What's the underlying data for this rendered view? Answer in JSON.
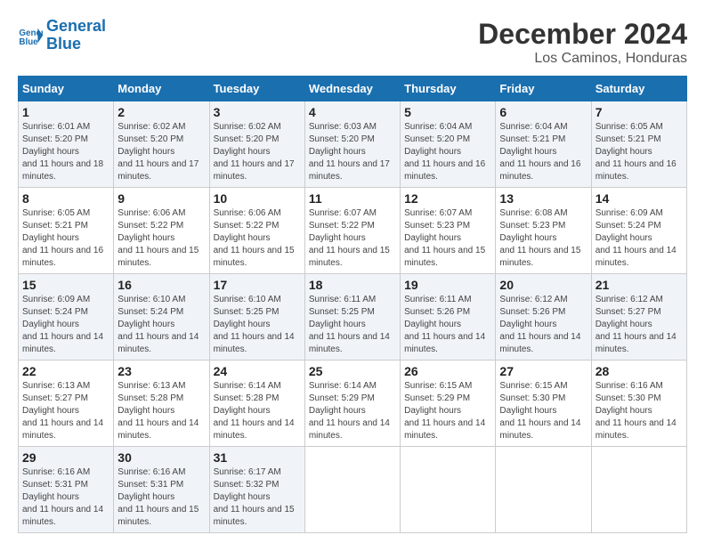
{
  "header": {
    "logo_line1": "General",
    "logo_line2": "Blue",
    "title": "December 2024",
    "subtitle": "Los Caminos, Honduras"
  },
  "calendar": {
    "days_of_week": [
      "Sunday",
      "Monday",
      "Tuesday",
      "Wednesday",
      "Thursday",
      "Friday",
      "Saturday"
    ],
    "weeks": [
      [
        {
          "day": "1",
          "sunrise": "6:01 AM",
          "sunset": "5:20 PM",
          "daylight": "11 hours and 18 minutes."
        },
        {
          "day": "2",
          "sunrise": "6:02 AM",
          "sunset": "5:20 PM",
          "daylight": "11 hours and 17 minutes."
        },
        {
          "day": "3",
          "sunrise": "6:02 AM",
          "sunset": "5:20 PM",
          "daylight": "11 hours and 17 minutes."
        },
        {
          "day": "4",
          "sunrise": "6:03 AM",
          "sunset": "5:20 PM",
          "daylight": "11 hours and 17 minutes."
        },
        {
          "day": "5",
          "sunrise": "6:04 AM",
          "sunset": "5:20 PM",
          "daylight": "11 hours and 16 minutes."
        },
        {
          "day": "6",
          "sunrise": "6:04 AM",
          "sunset": "5:21 PM",
          "daylight": "11 hours and 16 minutes."
        },
        {
          "day": "7",
          "sunrise": "6:05 AM",
          "sunset": "5:21 PM",
          "daylight": "11 hours and 16 minutes."
        }
      ],
      [
        {
          "day": "8",
          "sunrise": "6:05 AM",
          "sunset": "5:21 PM",
          "daylight": "11 hours and 16 minutes."
        },
        {
          "day": "9",
          "sunrise": "6:06 AM",
          "sunset": "5:22 PM",
          "daylight": "11 hours and 15 minutes."
        },
        {
          "day": "10",
          "sunrise": "6:06 AM",
          "sunset": "5:22 PM",
          "daylight": "11 hours and 15 minutes."
        },
        {
          "day": "11",
          "sunrise": "6:07 AM",
          "sunset": "5:22 PM",
          "daylight": "11 hours and 15 minutes."
        },
        {
          "day": "12",
          "sunrise": "6:07 AM",
          "sunset": "5:23 PM",
          "daylight": "11 hours and 15 minutes."
        },
        {
          "day": "13",
          "sunrise": "6:08 AM",
          "sunset": "5:23 PM",
          "daylight": "11 hours and 15 minutes."
        },
        {
          "day": "14",
          "sunrise": "6:09 AM",
          "sunset": "5:24 PM",
          "daylight": "11 hours and 14 minutes."
        }
      ],
      [
        {
          "day": "15",
          "sunrise": "6:09 AM",
          "sunset": "5:24 PM",
          "daylight": "11 hours and 14 minutes."
        },
        {
          "day": "16",
          "sunrise": "6:10 AM",
          "sunset": "5:24 PM",
          "daylight": "11 hours and 14 minutes."
        },
        {
          "day": "17",
          "sunrise": "6:10 AM",
          "sunset": "5:25 PM",
          "daylight": "11 hours and 14 minutes."
        },
        {
          "day": "18",
          "sunrise": "6:11 AM",
          "sunset": "5:25 PM",
          "daylight": "11 hours and 14 minutes."
        },
        {
          "day": "19",
          "sunrise": "6:11 AM",
          "sunset": "5:26 PM",
          "daylight": "11 hours and 14 minutes."
        },
        {
          "day": "20",
          "sunrise": "6:12 AM",
          "sunset": "5:26 PM",
          "daylight": "11 hours and 14 minutes."
        },
        {
          "day": "21",
          "sunrise": "6:12 AM",
          "sunset": "5:27 PM",
          "daylight": "11 hours and 14 minutes."
        }
      ],
      [
        {
          "day": "22",
          "sunrise": "6:13 AM",
          "sunset": "5:27 PM",
          "daylight": "11 hours and 14 minutes."
        },
        {
          "day": "23",
          "sunrise": "6:13 AM",
          "sunset": "5:28 PM",
          "daylight": "11 hours and 14 minutes."
        },
        {
          "day": "24",
          "sunrise": "6:14 AM",
          "sunset": "5:28 PM",
          "daylight": "11 hours and 14 minutes."
        },
        {
          "day": "25",
          "sunrise": "6:14 AM",
          "sunset": "5:29 PM",
          "daylight": "11 hours and 14 minutes."
        },
        {
          "day": "26",
          "sunrise": "6:15 AM",
          "sunset": "5:29 PM",
          "daylight": "11 hours and 14 minutes."
        },
        {
          "day": "27",
          "sunrise": "6:15 AM",
          "sunset": "5:30 PM",
          "daylight": "11 hours and 14 minutes."
        },
        {
          "day": "28",
          "sunrise": "6:16 AM",
          "sunset": "5:30 PM",
          "daylight": "11 hours and 14 minutes."
        }
      ],
      [
        {
          "day": "29",
          "sunrise": "6:16 AM",
          "sunset": "5:31 PM",
          "daylight": "11 hours and 14 minutes."
        },
        {
          "day": "30",
          "sunrise": "6:16 AM",
          "sunset": "5:31 PM",
          "daylight": "11 hours and 15 minutes."
        },
        {
          "day": "31",
          "sunrise": "6:17 AM",
          "sunset": "5:32 PM",
          "daylight": "11 hours and 15 minutes."
        },
        null,
        null,
        null,
        null
      ]
    ]
  }
}
